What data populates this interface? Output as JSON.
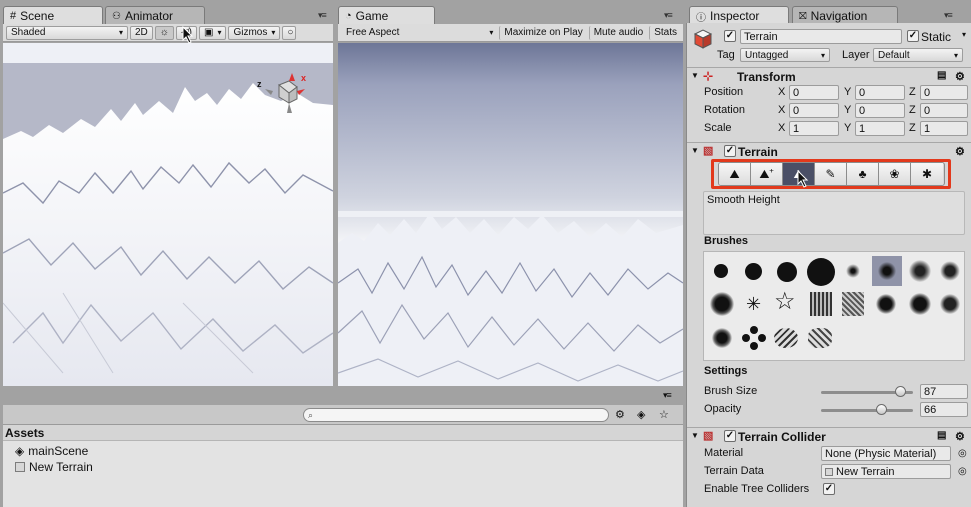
{
  "scene_panel": {
    "tab_scene": "Scene",
    "tab_animator": "Animator",
    "shading_mode": "Shaded",
    "btn_2d": "2D",
    "gizmos": "Gizmos",
    "axis_x": "x",
    "axis_z": "z"
  },
  "game_panel": {
    "tab_game": "Game",
    "aspect": "Free Aspect",
    "maximize_on_play": "Maximize on Play",
    "mute_audio": "Mute audio",
    "stats": "Stats"
  },
  "project_panel": {
    "assets_label": "Assets",
    "items": [
      {
        "name": "mainScene",
        "icon": "unity-scene-icon"
      },
      {
        "name": "New Terrain",
        "icon": "terrain-asset-icon"
      }
    ]
  },
  "inspector": {
    "tab_inspector": "Inspector",
    "tab_navigation": "Navigation",
    "object_name": "Terrain",
    "static_label": "Static",
    "static_checked": true,
    "tag_label": "Tag",
    "tag_value": "Untagged",
    "layer_label": "Layer",
    "layer_value": "Default",
    "transform": {
      "title": "Transform",
      "position_label": "Position",
      "rotation_label": "Rotation",
      "scale_label": "Scale",
      "position": {
        "x": "0",
        "y": "0",
        "z": "0"
      },
      "rotation": {
        "x": "0",
        "y": "0",
        "z": "0"
      },
      "scale": {
        "x": "1",
        "y": "1",
        "z": "1"
      },
      "x_label": "X",
      "y_label": "Y",
      "z_label": "Z"
    },
    "terrain": {
      "title": "Terrain",
      "enabled": true,
      "active_tool": "Smooth Height",
      "tools": [
        "raise-lower-icon",
        "paint-height-icon",
        "smooth-height-icon",
        "paint-texture-icon",
        "place-trees-icon",
        "paint-details-icon",
        "terrain-settings-icon"
      ],
      "brushes_label": "Brushes",
      "settings_label": "Settings",
      "brush_size_label": "Brush Size",
      "brush_size_value": "87",
      "brush_size_fraction": 0.86,
      "opacity_label": "Opacity",
      "opacity_value": "66",
      "opacity_fraction": 0.66
    },
    "terrain_collider": {
      "title": "Terrain Collider",
      "enabled": true,
      "material_label": "Material",
      "material_value": "None (Physic Material)",
      "terrain_data_label": "Terrain Data",
      "terrain_data_value": "New Terrain",
      "tree_colliders_label": "Enable Tree Colliders",
      "tree_colliders_checked": true
    }
  },
  "colors": {
    "highlight_box": "#e2391c",
    "selected_tool": "#4a4f66",
    "panel_bg": "#d6d6d6"
  }
}
